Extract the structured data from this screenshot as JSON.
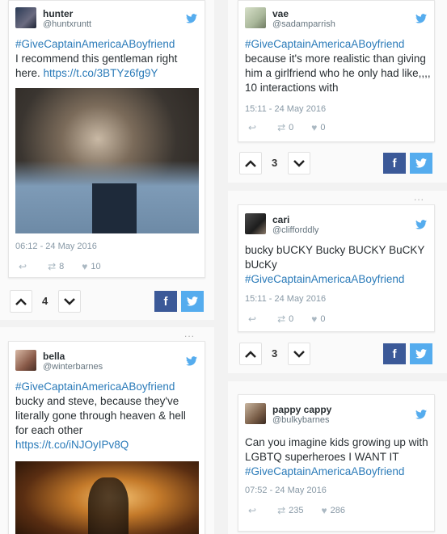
{
  "posts": [
    {
      "name": "hunter",
      "handle": "@huntxruntt",
      "hashtag": "#GiveCaptainAmericaABoyfriend",
      "text": "I recommend this gentleman right here.",
      "link": "https://t.co/3BTYz6fg9Y",
      "time": "06:12 - 24 May 2016",
      "retweets": "8",
      "likes": "10",
      "votes": "4"
    },
    {
      "name": "vae",
      "handle": "@sadamparrish",
      "hashtag": "#GiveCaptainAmericaABoyfriend",
      "text": "because it's more realistic than giving him a girlfriend who he only had like,,,, 10 interactions with",
      "time": "15:11 - 24 May 2016",
      "retweets": "0",
      "likes": "0",
      "votes": "3"
    },
    {
      "name": "cari",
      "handle": "@clifforddly",
      "text": "bucky bUCKY Bucky BUCKY BuCKY bUcKy",
      "hashtag": "#GiveCaptainAmericaABoyfriend",
      "time": "15:11 - 24 May 2016",
      "retweets": "0",
      "likes": "0",
      "votes": "3"
    },
    {
      "name": "bella",
      "handle": "@winterbarnes",
      "hashtag": "#GiveCaptainAmericaABoyfriend",
      "text": "bucky and steve, because they've literally gone through heaven & hell for each other",
      "link": "https://t.co/iNJOyIPv8Q"
    },
    {
      "name": "pappy cappy",
      "handle": "@bulkybarnes",
      "text": "Can you imagine kids growing up with LGBTQ superheroes I WANT IT",
      "hashtag": "#GiveCaptainAmericaABoyfriend",
      "time": "07:52 - 24 May 2016",
      "retweets": "235",
      "likes": "286"
    }
  ],
  "share": {
    "fb": "f"
  },
  "colors": {
    "link": "#2b7bb9",
    "facebook": "#3b5998",
    "twitter": "#55acee"
  }
}
